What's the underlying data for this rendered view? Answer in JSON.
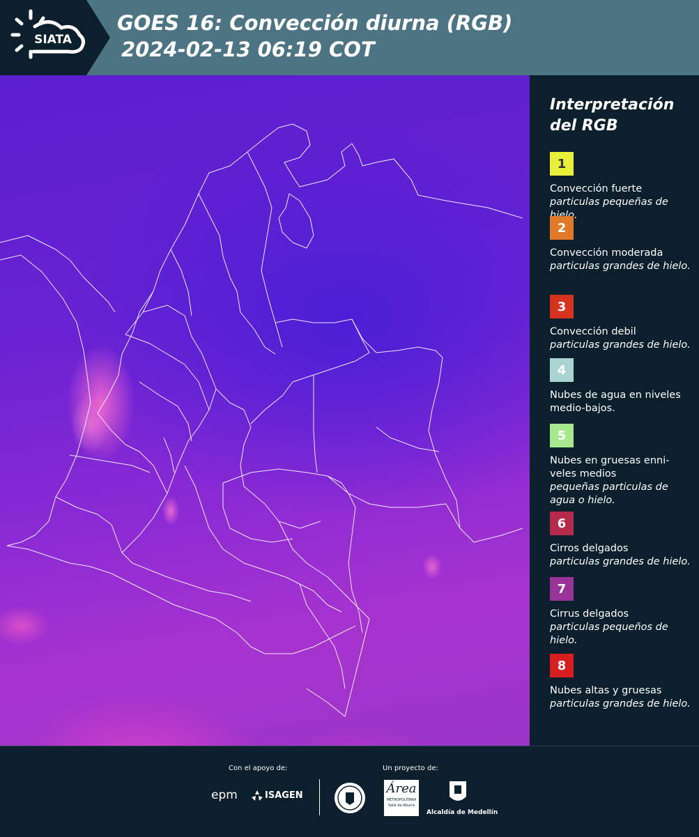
{
  "header": {
    "logo_text": "SIATA",
    "title_line1": "GOES 16: Convección diurna (RGB)",
    "title_line2": "2024-02-13 06:19 COT"
  },
  "legend": {
    "title": "Interpretación del RGB",
    "items": [
      {
        "num": "1",
        "color": "#e8f03a",
        "numcolor": "#333333",
        "label": "Convección fuerte",
        "sub": "particulas pequeñas de hielo."
      },
      {
        "num": "2",
        "color": "#e07a28",
        "numcolor": "#ffffff",
        "label": "Convección moderada",
        "sub": "particulas grandes de hielo."
      },
      {
        "num": "3",
        "color": "#d6321e",
        "numcolor": "#ffffff",
        "label": "Convección debil",
        "sub": "particulas grandes de hielo."
      },
      {
        "num": "4",
        "color": "#a9d4d2",
        "numcolor": "#ffffff",
        "label": "Nubes de agua en niveles medio-bajos.",
        "sub": ""
      },
      {
        "num": "5",
        "color": "#a7e88e",
        "numcolor": "#ffffff",
        "label": "Nubes en gruesas enni-veles medios",
        "sub": "pequeñas particulas de agua o hielo."
      },
      {
        "num": "6",
        "color": "#b52a4a",
        "numcolor": "#ffffff",
        "label": "Cirros delgados",
        "sub": "particulas grandes de hielo."
      },
      {
        "num": "7",
        "color": "#9a3397",
        "numcolor": "#ffffff",
        "label": "Cirrus delgados",
        "sub": "particulas pequeños de hielo."
      },
      {
        "num": "8",
        "color": "#d81f1f",
        "numcolor": "#ffffff",
        "label": "Nubes altas y gruesas",
        "sub": "particulas grandes de hielo."
      }
    ]
  },
  "footer": {
    "support_label": "Con el apoyo de:",
    "project_label": "Un proyecto de:",
    "sponsor1": "epm",
    "sponsor2": "ISAGEN",
    "partner_area": "Área",
    "partner_area_sub": "METROPOLITANA",
    "partner_area_sub2": "Valle de Aburrá",
    "partner_medellin": "Alcaldía de Medellín"
  }
}
